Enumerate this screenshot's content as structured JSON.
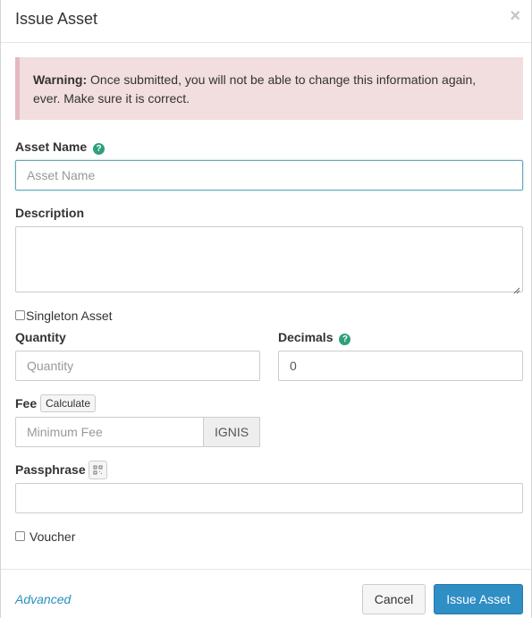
{
  "modal": {
    "title": "Issue Asset",
    "close_glyph": "×",
    "warning": {
      "strong": "Warning:",
      "text": "Once submitted, you will not be able to change this information again, ever. Make sure it is correct."
    },
    "asset_name": {
      "label": "Asset Name",
      "placeholder": "Asset Name",
      "value": ""
    },
    "description": {
      "label": "Description",
      "value": ""
    },
    "singleton": {
      "label": "Singleton Asset",
      "checked": false
    },
    "quantity": {
      "label": "Quantity",
      "placeholder": "Quantity",
      "value": ""
    },
    "decimals": {
      "label": "Decimals",
      "value": "0"
    },
    "fee": {
      "label": "Fee",
      "calculate_label": "Calculate",
      "placeholder": "Minimum Fee",
      "currency": "IGNIS"
    },
    "passphrase": {
      "label": "Passphrase",
      "value": ""
    },
    "voucher": {
      "label": "Voucher",
      "checked": false
    },
    "footer": {
      "advanced_label": "Advanced",
      "cancel_label": "Cancel",
      "submit_label": "Issue Asset"
    },
    "help_glyph": "?",
    "icons": {
      "help": "question-circle-icon",
      "qr": "qr-code-icon",
      "close": "close-icon"
    },
    "colors": {
      "help_icon": "#2ea07b",
      "primary": "#2f8ec4",
      "warning_bg": "#f2dede",
      "link": "#2a8fbd"
    }
  }
}
